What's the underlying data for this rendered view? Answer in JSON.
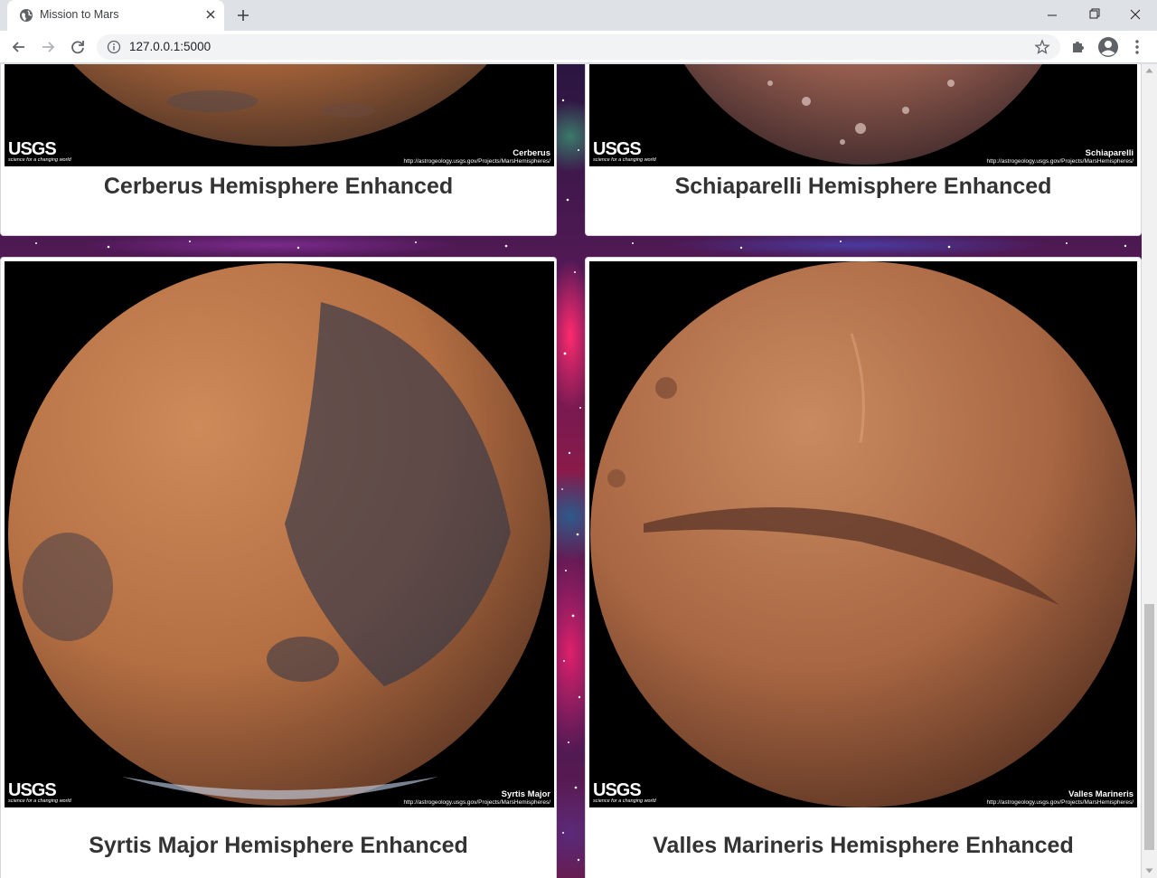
{
  "browser": {
    "tab_title": "Mission to Mars",
    "url": "127.0.0.1:5000"
  },
  "hemispheres": [
    {
      "title": "Cerberus Hemisphere Enhanced",
      "image_label": "Cerberus",
      "image_url_text": "http://astrogeology.usgs.gov/Projects/MarsHemispheres/",
      "logo": "USGS",
      "logo_tagline": "science for a changing world"
    },
    {
      "title": "Schiaparelli Hemisphere Enhanced",
      "image_label": "Schiaparelli",
      "image_url_text": "http://astrogeology.usgs.gov/Projects/MarsHemispheres/",
      "logo": "USGS",
      "logo_tagline": "science for a changing world"
    },
    {
      "title": "Syrtis Major Hemisphere Enhanced",
      "image_label": "Syrtis Major",
      "image_url_text": "http://astrogeology.usgs.gov/Projects/MarsHemispheres/",
      "logo": "USGS",
      "logo_tagline": "science for a changing world"
    },
    {
      "title": "Valles Marineris Hemisphere Enhanced",
      "image_label": "Valles Marineris",
      "image_url_text": "http://astrogeology.usgs.gov/Projects/MarsHemispheres/",
      "logo": "USGS",
      "logo_tagline": "science for a changing world"
    }
  ],
  "colors": {
    "title_text": "#333333",
    "mars_base": "#b8703f",
    "mars_dark": "#3a3540"
  },
  "icons": {
    "tab_favicon": "globe-icon",
    "tab_close": "close-icon",
    "new_tab": "plus-icon",
    "back": "arrow-left-icon",
    "forward": "arrow-right-icon",
    "reload": "reload-icon",
    "site_info": "info-icon",
    "bookmark": "star-icon",
    "extensions": "puzzle-icon",
    "profile": "account-icon",
    "menu": "kebab-menu-icon"
  }
}
